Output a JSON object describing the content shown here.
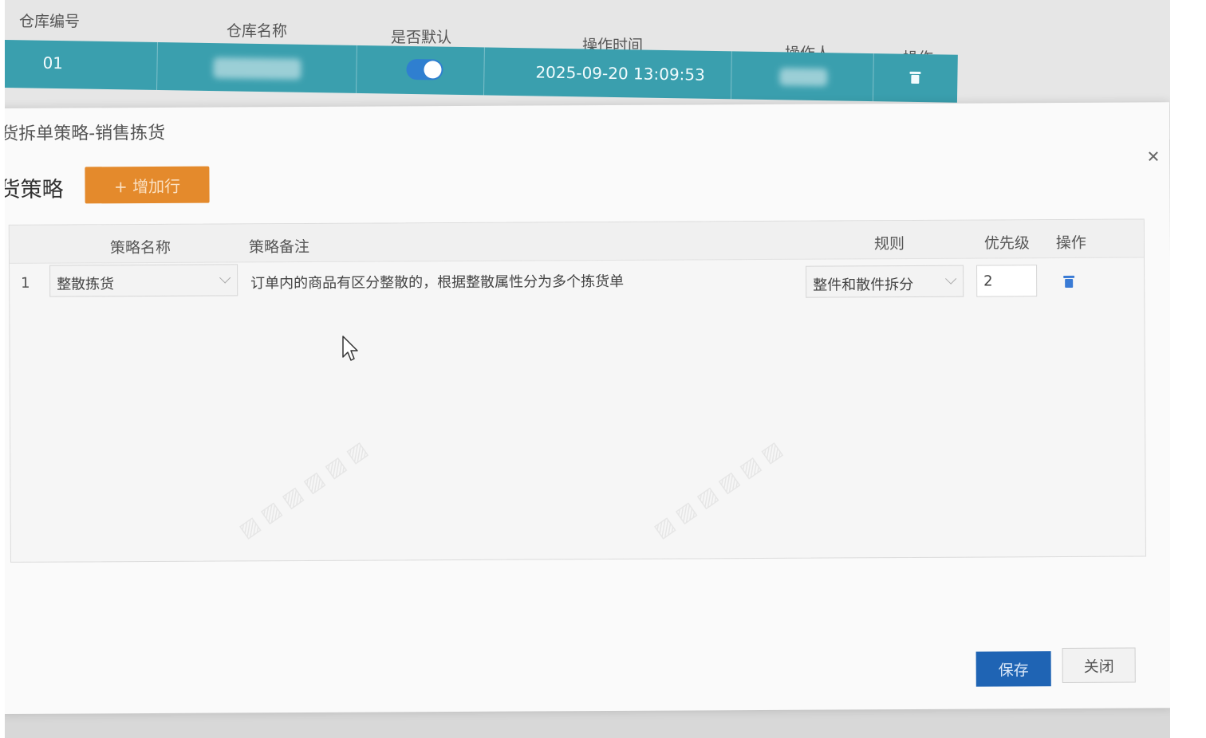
{
  "background_table": {
    "headers": {
      "warehouse_code": "仓库编号",
      "warehouse_name": "仓库名称",
      "is_default": "是否默认",
      "operation_time": "操作时间",
      "operator": "操作人",
      "action": "操作"
    },
    "selected_row": {
      "warehouse_code": "01",
      "is_default": true,
      "operation_time": "2025-09-20 13:09:53"
    },
    "colors": {
      "selected_row": "#3a9fae",
      "toggle_on": "#2f7fd0"
    }
  },
  "modal": {
    "title": "货拆单策略-销售拣货",
    "section_title": "货策略",
    "add_row_button": "+ 增加行",
    "close_icon": "close-icon",
    "columns": {
      "strategy_name": "策略名称",
      "strategy_remark": "策略备注",
      "rule": "规则",
      "priority": "优先级",
      "action": "操作"
    },
    "rows": [
      {
        "index": "1",
        "strategy_name": "整散拣货",
        "strategy_remark": "订单内的商品有区分整散的，根据整散属性分为多个拣货单",
        "rule": "整件和散件拆分",
        "priority": "2",
        "action_icon": "trash-icon"
      }
    ],
    "footer": {
      "save_button": "保存",
      "close_button": "关闭"
    },
    "colors": {
      "add_button": "#e48a2c",
      "save_button": "#1f64b4",
      "delete_icon": "#3a7bd5"
    }
  }
}
